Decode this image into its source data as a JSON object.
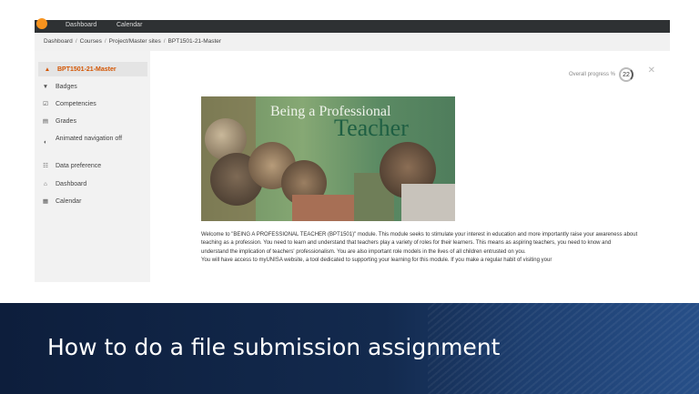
{
  "topnav": {
    "links": [
      "Dashboard",
      "Calendar"
    ]
  },
  "breadcrumb": [
    "Dashboard",
    "Courses",
    "Project/Master sites",
    "BPT1501-21-Master"
  ],
  "drawer": {
    "items": [
      {
        "label": "BPT1501-21-Master",
        "icon": "graduation-cap-icon"
      },
      {
        "label": "Badges",
        "icon": "shield-icon"
      },
      {
        "label": "Competencies",
        "icon": "checkbox-icon"
      },
      {
        "label": "Grades",
        "icon": "table-icon"
      },
      {
        "label": "Animated navigation off",
        "icon": "toggle-icon"
      },
      {
        "label": "Data preference",
        "icon": "database-icon"
      },
      {
        "label": "Dashboard",
        "icon": "home-icon"
      },
      {
        "label": "Calendar",
        "icon": "calendar-icon"
      }
    ]
  },
  "course": {
    "progress_label": "Overall progress %",
    "progress_value": "22",
    "banner_line1": "Being a Professional",
    "banner_line2": "Teacher",
    "description": "Welcome to \"BEING A PROFESSIONAL TEACHER (BPT1501)\" module. This module seeks to stimulate your interest in education and more importantly raise your awareness about teaching as a profession. You need to learn and understand that teachers play a variety of roles for their learners. This means as aspiring teachers, you need to know and understand the implication of teachers' professionalism. You are also important role models in the lives of all children entrusted on you.",
    "description2": "You will have access to myUNISA website, a tool dedicated to supporting your learning for this module. If you make a regular habit of visiting your"
  },
  "caption": "How to do a file submission assignment",
  "colors": {
    "accent": "#d35400",
    "band": "#132a4e"
  }
}
